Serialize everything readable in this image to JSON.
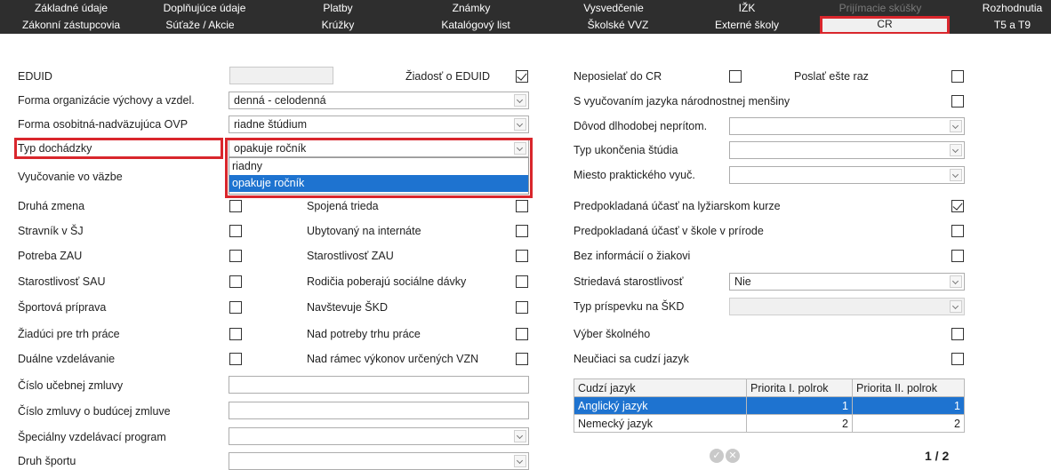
{
  "tabs_row1": [
    {
      "label": "Základné údaje"
    },
    {
      "label": "Doplňujúce údaje"
    },
    {
      "label": "Platby"
    },
    {
      "label": "Známky"
    },
    {
      "label": "Vysvedčenie"
    },
    {
      "label": "IŽK"
    },
    {
      "label": "Prijímacie skúšky"
    },
    {
      "label": "Rozhodnutia"
    }
  ],
  "tabs_row2": [
    {
      "label": "Zákonní zástupcovia"
    },
    {
      "label": "Súťaže / Akcie"
    },
    {
      "label": "Krúžky"
    },
    {
      "label": "Katalógový list"
    },
    {
      "label": "Školské VVZ"
    },
    {
      "label": "Externé školy"
    },
    {
      "label": "CR"
    },
    {
      "label": "T5 a T9"
    }
  ],
  "left": {
    "eduid": {
      "label": "EDUID",
      "value": ""
    },
    "ziadost_eduid": {
      "label": "Žiadosť o EDUID",
      "checked": true
    },
    "forma_org": {
      "label": "Forma organizácie výchovy a vzdel.",
      "value": "denná - celodenná"
    },
    "forma_osob": {
      "label": "Forma osobitná-nadväzujúca OVP",
      "value": "riadne štúdium"
    },
    "typ_dochadzky": {
      "label": "Typ dochádzky",
      "value": "opakuje ročník",
      "options": [
        "riadny",
        "opakuje ročník"
      ],
      "selected_option": "opakuje ročník"
    },
    "vyucovanie_vo_vazbe": {
      "label": "Vyučovanie vo väzbe"
    },
    "druha_zmena": {
      "label": "Druhá zmena",
      "checked": false
    },
    "spojena_trieda": {
      "label": "Spojená trieda",
      "checked": false
    },
    "stravnik": {
      "label": "Stravník v ŠJ",
      "checked": false
    },
    "ubytovany": {
      "label": "Ubytovaný na internáte",
      "checked": false
    },
    "potreba_zau": {
      "label": "Potreba ZAU",
      "checked": false
    },
    "starostlivost_zau": {
      "label": "Starostlivosť ZAU",
      "checked": false
    },
    "starostlivost_sau": {
      "label": "Starostlivosť SAU",
      "checked": false
    },
    "rodicia_davky": {
      "label": "Rodičia poberajú sociálne dávky",
      "checked": false
    },
    "sportova_priprava": {
      "label": "Športová príprava",
      "checked": false
    },
    "navstevuje_skd": {
      "label": "Navštevuje ŠKD",
      "checked": false
    },
    "ziadaci_trh": {
      "label": "Žiadúci pre trh práce",
      "checked": false
    },
    "nad_potreby": {
      "label": "Nad potreby trhu práce",
      "checked": false
    },
    "dualne": {
      "label": "Duálne vzdelávanie",
      "checked": false
    },
    "nad_ramec": {
      "label": "Nad rámec výkonov určených VZN",
      "checked": false
    },
    "cislo_ucebnej": {
      "label": "Číslo učebnej zmluvy",
      "value": ""
    },
    "cislo_buducej": {
      "label": "Číslo zmluvy o budúcej zmluve",
      "value": ""
    },
    "specialny_program": {
      "label": "Špeciálny vzdelávací program",
      "value": ""
    },
    "druh_sportu": {
      "label": "Druh športu",
      "value": ""
    }
  },
  "right": {
    "neposielat_cr": {
      "label": "Neposielať do CR",
      "checked": false
    },
    "poslat_este_raz": {
      "label": "Poslať ešte raz",
      "checked": false
    },
    "narodnostna_mensina": {
      "label": "S vyučovaním jazyka národnostnej menšiny",
      "checked": false
    },
    "dovod_nepritom": {
      "label": "Dôvod dlhodobej neprítom.",
      "value": ""
    },
    "typ_ukoncenia": {
      "label": "Typ ukončenia štúdia",
      "value": ""
    },
    "miesto_prakt": {
      "label": "Miesto praktického vyuč.",
      "value": ""
    },
    "lyziarsky": {
      "label": "Predpokladaná účasť na lyžiarskom kurze",
      "checked": true
    },
    "skola_v_prirode": {
      "label": "Predpokladaná účasť v škole v prírode",
      "checked": false
    },
    "bez_informacii": {
      "label": "Bez informácií o žiakovi",
      "checked": false
    },
    "striedava": {
      "label": "Striedavá starostlivosť",
      "value": "Nie"
    },
    "typ_prispevku": {
      "label": "Typ príspevku na ŠKD",
      "value": ""
    },
    "vyber_skolneho": {
      "label": "Výber školného",
      "checked": false
    },
    "neuciaci": {
      "label": "Neučiaci sa cudzí jazyk",
      "checked": false
    },
    "jazyky_table": {
      "headers": [
        "Cudzí jazyk",
        "Priorita I. polrok",
        "Priorita II. polrok"
      ],
      "rows": [
        {
          "jazyk": "Anglický jazyk",
          "p1": "1",
          "p2": "1",
          "selected": true
        },
        {
          "jazyk": "Nemecký jazyk",
          "p1": "2",
          "p2": "2",
          "selected": false
        }
      ]
    },
    "pager": "1 / 2"
  },
  "colors": {
    "highlight_red": "#d9262c",
    "selection_blue": "#1e73d0",
    "tab_bg": "#2e2e2e"
  }
}
